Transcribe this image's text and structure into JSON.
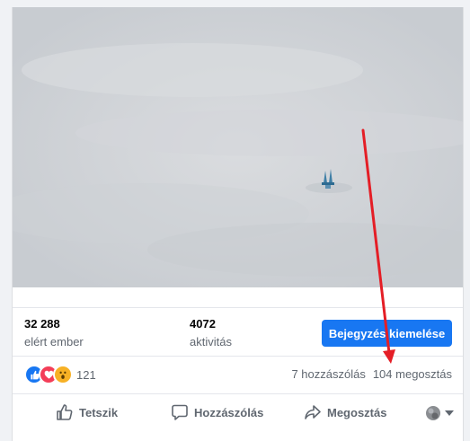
{
  "stats": {
    "reach_value": "32 288",
    "reach_label": "elért ember",
    "engagement_value": "4072",
    "engagement_label": "aktivitás"
  },
  "boost_button_label": "Bejegyzés kiemelése",
  "reactions": {
    "icons": [
      "like-icon",
      "love-icon",
      "wow-icon"
    ],
    "count": "121"
  },
  "engagement": {
    "comments": "7 hozzászólás",
    "shares": "104 megosztás"
  },
  "actions": {
    "like_label": "Tetszik",
    "comment_label": "Hozzászólás",
    "share_label": "Megosztás"
  },
  "colors": {
    "accent": "#1877f2",
    "annotation_arrow": "#e41e26",
    "love": "#f33e58",
    "wow": "#f7b125"
  }
}
